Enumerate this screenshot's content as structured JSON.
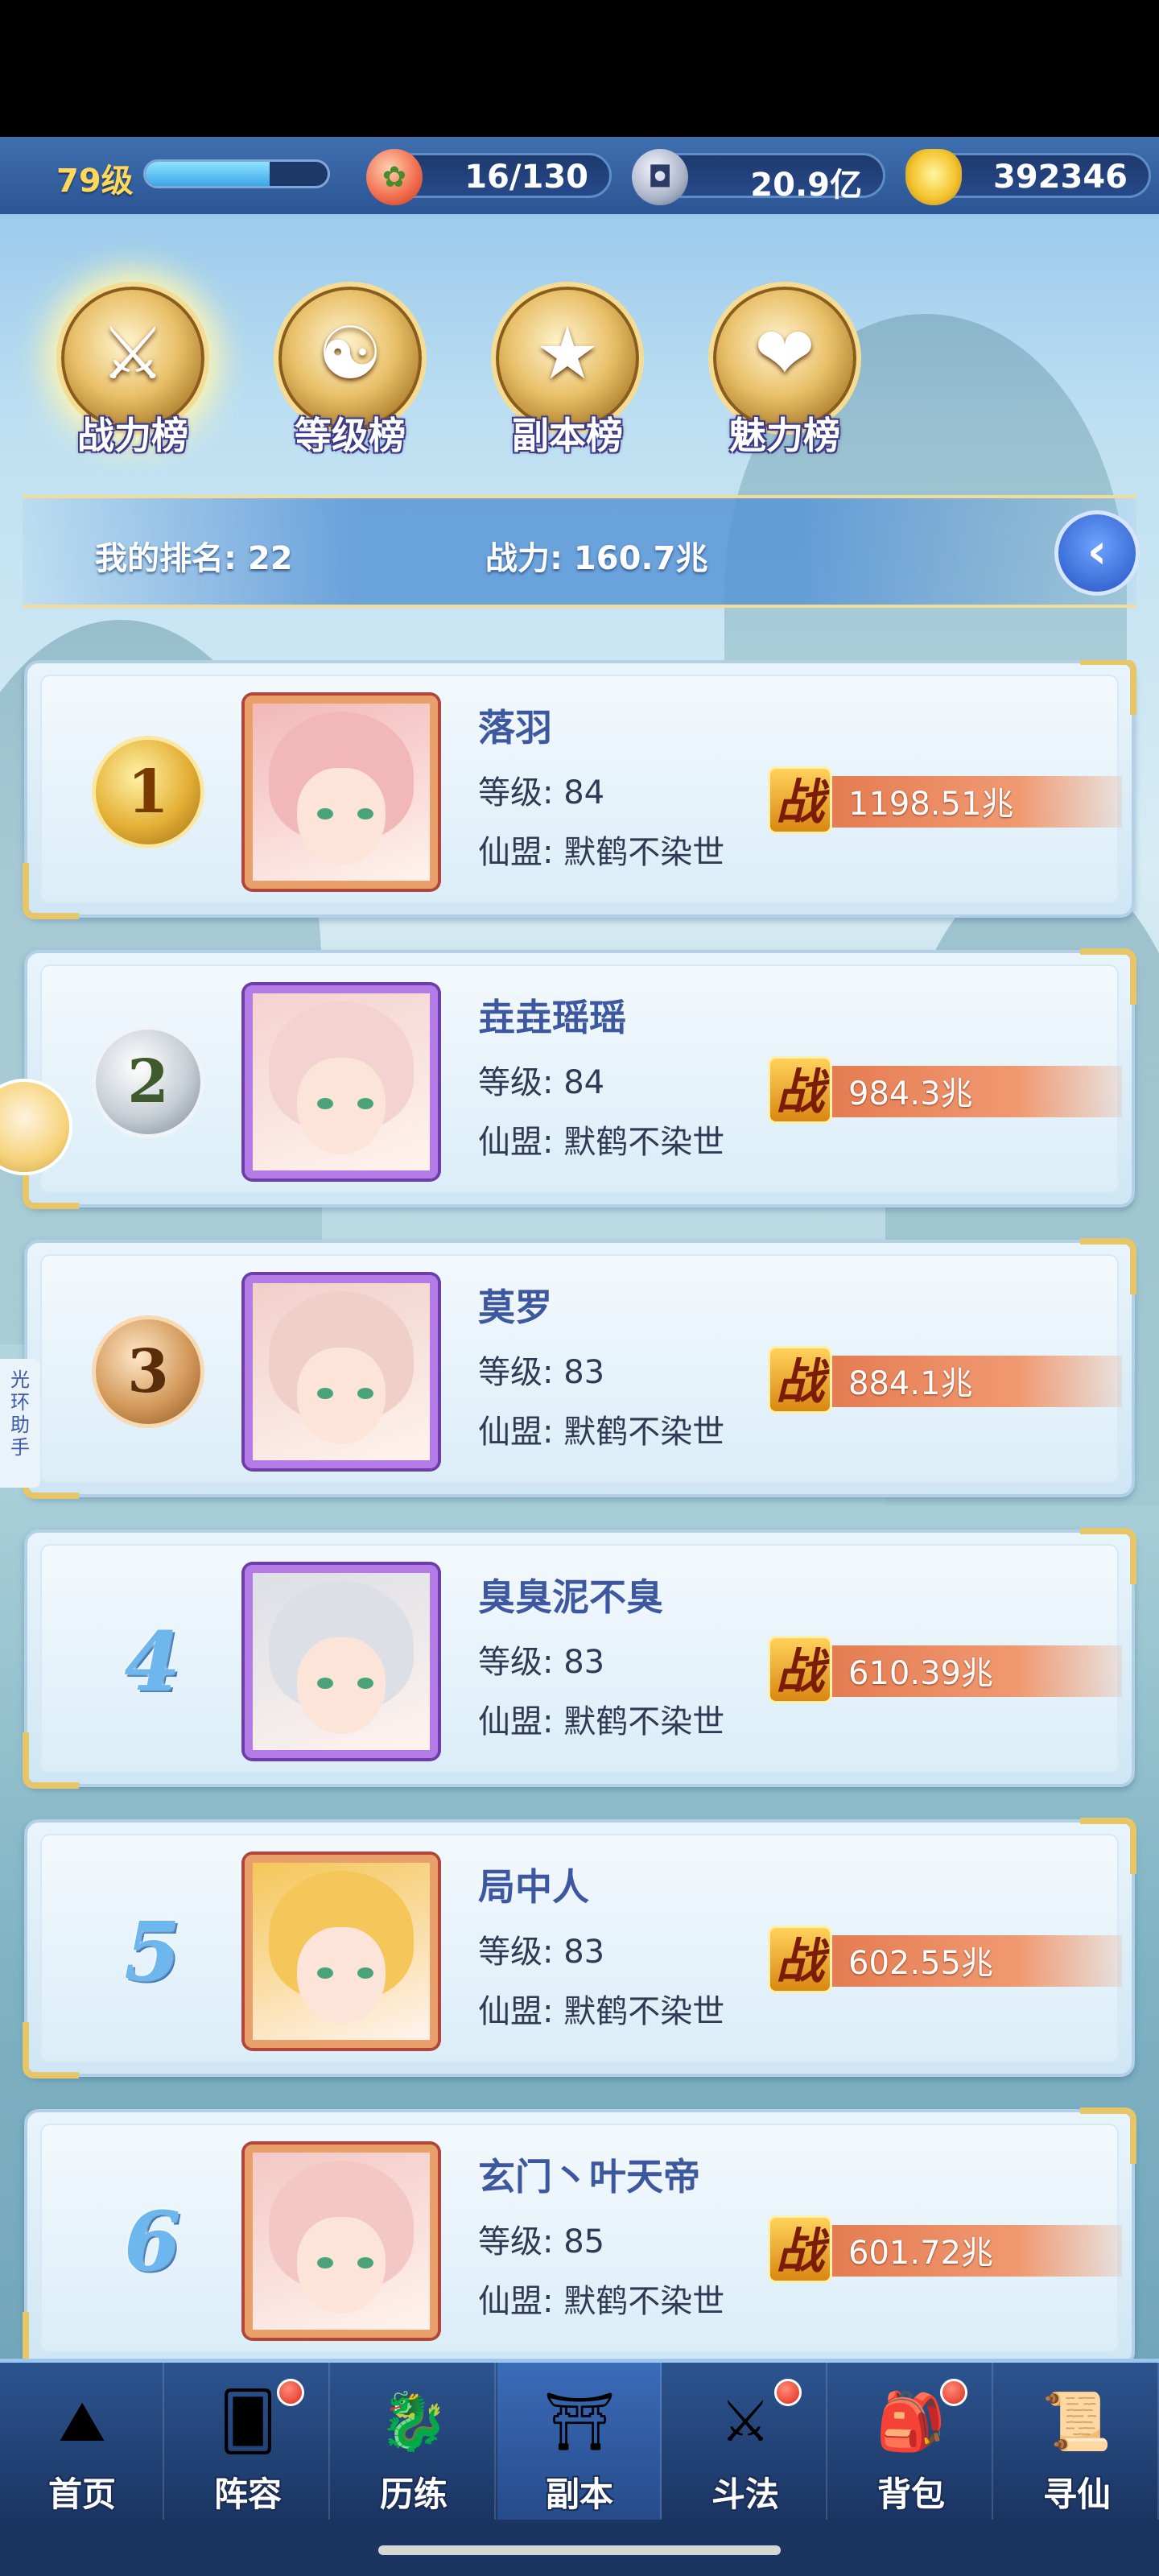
{
  "resources": {
    "level": "79级",
    "exp_progress": 0.68,
    "stamina": "16/130",
    "copper": "20.9亿",
    "gold": "392346"
  },
  "tabs": [
    {
      "label": "战力榜",
      "glyph": "⚔",
      "active": true
    },
    {
      "label": "等级榜",
      "glyph": "☯",
      "active": false
    },
    {
      "label": "副本榜",
      "glyph": "★",
      "active": false
    },
    {
      "label": "魅力榜",
      "glyph": "❤",
      "active": false
    }
  ],
  "my_rank": {
    "rank_text": "我的排名: 22",
    "power_text": "战力: 160.7兆"
  },
  "players": [
    {
      "rank": "1",
      "medal": "gold",
      "name": "落羽",
      "level": "等级: 84",
      "guild": "仙盟: 默鹤不染世",
      "power": "1198.51兆",
      "frame": "red",
      "hair": "#f2b8b8"
    },
    {
      "rank": "2",
      "medal": "silver",
      "name": "垚垚瑶瑶",
      "level": "等级: 84",
      "guild": "仙盟: 默鹤不染世",
      "power": "984.3兆",
      "frame": "purple",
      "hair": "#f4d2cf"
    },
    {
      "rank": "3",
      "medal": "bronze",
      "name": "莫罗",
      "level": "等级: 83",
      "guild": "仙盟: 默鹤不染世",
      "power": "884.1兆",
      "frame": "purple",
      "hair": "#f1cfc9"
    },
    {
      "rank": "4",
      "medal": "",
      "name": "臭臭泥不臭",
      "level": "等级: 83",
      "guild": "仙盟: 默鹤不染世",
      "power": "610.39兆",
      "frame": "purple",
      "hair": "#dcdfe6"
    },
    {
      "rank": "5",
      "medal": "",
      "name": "局中人",
      "level": "等级: 83",
      "guild": "仙盟: 默鹤不染世",
      "power": "602.55兆",
      "frame": "red",
      "hair": "#f5c659"
    },
    {
      "rank": "6",
      "medal": "",
      "name": "玄门丶叶天帝",
      "level": "等级: 85",
      "guild": "仙盟: 默鹤不染世",
      "power": "601.72兆",
      "frame": "red",
      "hair": "#f3c8c4"
    }
  ],
  "power_icon": "战",
  "side_tab": "光环助手",
  "nav": [
    {
      "label": "首页",
      "glyph": "⛰",
      "dot": false,
      "active": false
    },
    {
      "label": "阵容",
      "glyph": "🂠",
      "dot": true,
      "active": false
    },
    {
      "label": "历练",
      "glyph": "🐉",
      "dot": false,
      "active": false
    },
    {
      "label": "副本",
      "glyph": "⛩",
      "dot": false,
      "active": true
    },
    {
      "label": "斗法",
      "glyph": "⚔",
      "dot": true,
      "active": false
    },
    {
      "label": "背包",
      "glyph": "🎒",
      "dot": true,
      "active": false
    },
    {
      "label": "寻仙",
      "glyph": "📜",
      "dot": false,
      "active": false
    }
  ],
  "colors": {
    "accent_gold": "#e7c66a",
    "name_blue": "#3e58a0",
    "power_orange": "#e2744a"
  }
}
